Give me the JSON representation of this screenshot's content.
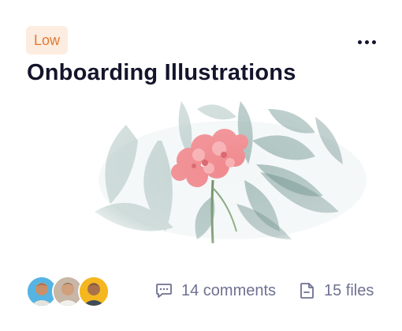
{
  "card": {
    "priority": "Low",
    "title": "Onboarding Illustrations",
    "menu_icon": "more-horizontal-icon",
    "image_subject": "pink geranium flower with faded green leaves",
    "members": [
      {
        "name": "avatar-1",
        "bg": "#56b4e3"
      },
      {
        "name": "avatar-2",
        "bg": "#c8b6a6"
      },
      {
        "name": "avatar-3",
        "bg": "#f5b71f"
      }
    ],
    "comments": {
      "icon": "comment-icon",
      "label": "14 comments"
    },
    "files": {
      "icon": "file-icon",
      "label": "15 files"
    }
  },
  "colors": {
    "badge_bg": "#fdece0",
    "badge_text": "#e07a33",
    "title": "#14142b",
    "meta_text": "#6e7191"
  }
}
